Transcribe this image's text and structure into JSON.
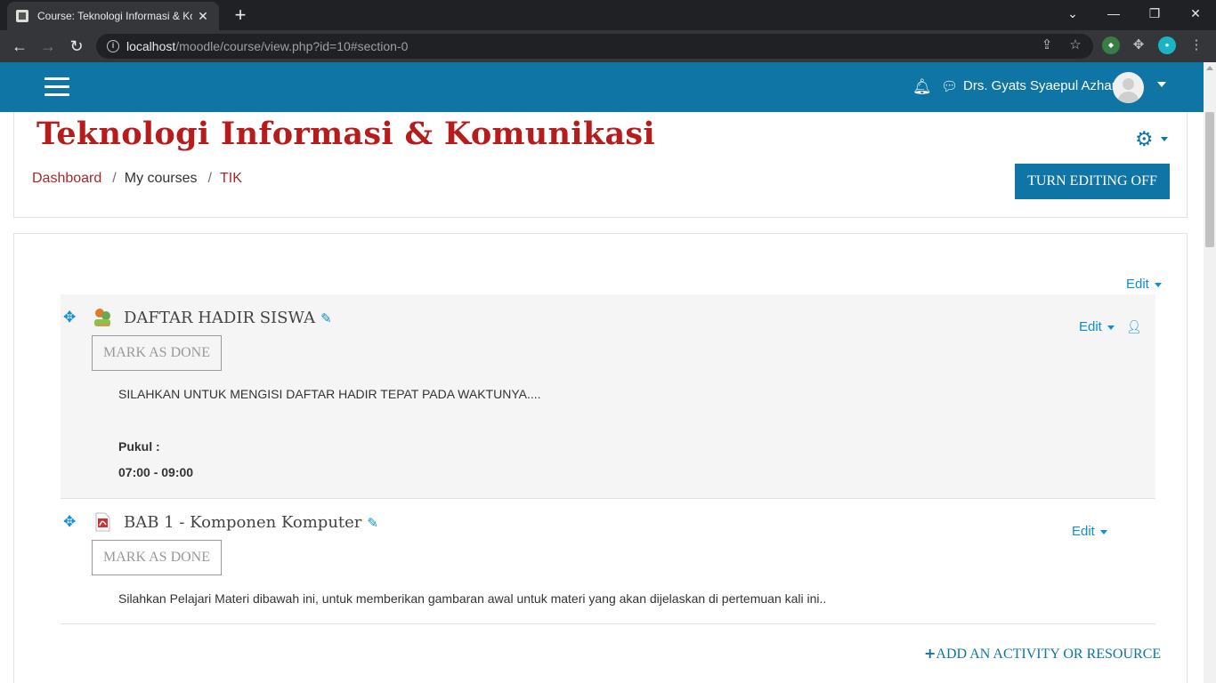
{
  "browser": {
    "tab_title": "Course: Teknologi Informasi & Ko",
    "url_host": "localhost",
    "url_path": "/moodle/course/view.php?id=10#section-0"
  },
  "navbar": {
    "user_name": "Drs. Gyats Syaepul Azhar"
  },
  "header": {
    "title": "Teknologi Informasi & Komunikasi",
    "breadcrumb": [
      "Dashboard",
      "My courses",
      "TIK"
    ],
    "editing_button": "TURN EDITING OFF"
  },
  "section": {
    "edit_label": "Edit",
    "add_activity_label": "ADD AN ACTIVITY OR RESOURCE",
    "activities": [
      {
        "title": "DAFTAR HADIR SISWA",
        "mark_done": "MARK AS DONE",
        "edit_label": "Edit",
        "desc_line1": "SILAHKAN UNTUK MENGISI DAFTAR HADIR TEPAT PADA WAKTUNYA....",
        "desc_line2": "Pukul :",
        "desc_line3": "07:00 - 09:00"
      },
      {
        "title": "BAB 1 - Komponen Komputer",
        "mark_done": "MARK AS DONE",
        "edit_label": "Edit",
        "desc_line1": "Silahkan Pelajari Materi dibawah ini, untuk memberikan gambaran awal untuk materi yang akan dijelaskan di pertemuan kali ini.."
      }
    ]
  },
  "colors": {
    "brand": "#0e75a5",
    "title": "#b71c1c",
    "link": "#0e8fd1"
  }
}
